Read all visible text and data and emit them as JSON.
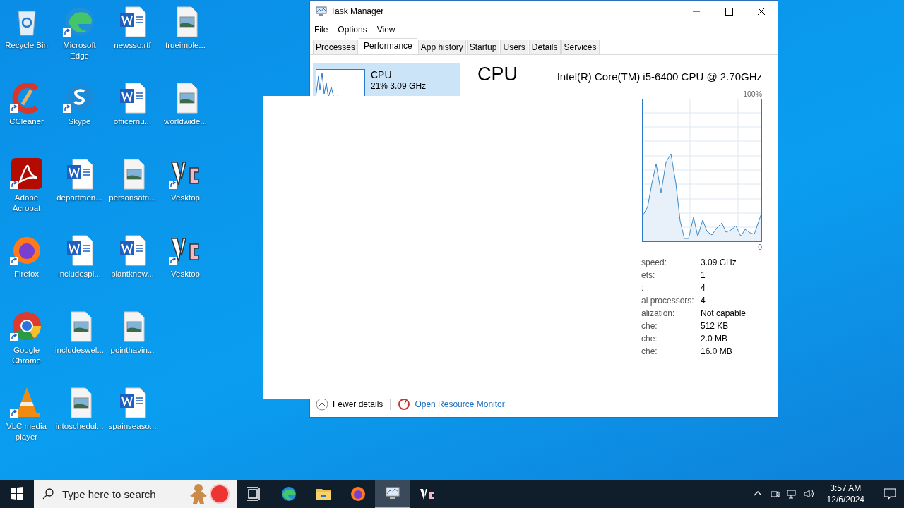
{
  "desktop_icons": [
    {
      "label": "Recycle Bin",
      "kind": "recycle",
      "shortcut": false
    },
    {
      "label": "CCleaner",
      "kind": "ccleaner",
      "shortcut": true
    },
    {
      "label": "Adobe Acrobat",
      "kind": "acrobat",
      "shortcut": true
    },
    {
      "label": "Firefox",
      "kind": "firefox",
      "shortcut": true
    },
    {
      "label": "Google Chrome",
      "kind": "chrome",
      "shortcut": true
    },
    {
      "label": "VLC media player",
      "kind": "vlc",
      "shortcut": true
    },
    {
      "label": "Microsoft Edge",
      "kind": "edge",
      "shortcut": true
    },
    {
      "label": "Skype",
      "kind": "skype",
      "shortcut": true
    },
    {
      "label": "departmen...",
      "kind": "word",
      "shortcut": false
    },
    {
      "label": "includespl...",
      "kind": "word",
      "shortcut": false
    },
    {
      "label": "includeswel...",
      "kind": "image",
      "shortcut": false
    },
    {
      "label": "intoschedul...",
      "kind": "image",
      "shortcut": false
    },
    {
      "label": "newsso.rtf",
      "kind": "word",
      "shortcut": false
    },
    {
      "label": "officernu...",
      "kind": "word",
      "shortcut": false
    },
    {
      "label": "personsafri...",
      "kind": "image",
      "shortcut": false
    },
    {
      "label": "plantknow...",
      "kind": "word",
      "shortcut": false
    },
    {
      "label": "pointhavin...",
      "kind": "image",
      "shortcut": false
    },
    {
      "label": "spainseaso...",
      "kind": "word",
      "shortcut": false
    },
    {
      "label": "trueimple...",
      "kind": "image",
      "shortcut": false
    },
    {
      "label": "worldwide...",
      "kind": "image",
      "shortcut": false
    },
    {
      "label": "Vesktop",
      "kind": "vesktop",
      "shortcut": true
    },
    {
      "label": "Vesktop",
      "kind": "vesktop",
      "shortcut": true
    }
  ],
  "task_manager": {
    "title": "Task Manager",
    "menu": [
      "File",
      "Options",
      "View"
    ],
    "tabs": [
      {
        "label": "Processes",
        "selected": false
      },
      {
        "label": "Performance",
        "selected": true
      },
      {
        "label": "App history",
        "selected": false
      },
      {
        "label": "Startup",
        "selected": false
      },
      {
        "label": "Users",
        "selected": false
      },
      {
        "label": "Details",
        "selected": false
      },
      {
        "label": "Services",
        "selected": false
      }
    ],
    "sidebar": [
      {
        "name": "CPU",
        "detail": "21%  3.09 GHz",
        "selected": true
      }
    ],
    "heading": "CPU",
    "processor": "Intel(R) Core(TM) i5-6400 CPU @ 2.70GHz",
    "graph_max": "100%",
    "graph_min": "0",
    "stats": [
      {
        "label": "speed:",
        "value": "3.09 GHz"
      },
      {
        "label": "ets:",
        "value": "1"
      },
      {
        "label": ":",
        "value": "4"
      },
      {
        "label": "al processors:",
        "value": "4"
      },
      {
        "label": "alization:",
        "value": "Not capable"
      },
      {
        "label": "che:",
        "value": "512 KB"
      },
      {
        "label": "che:",
        "value": "2.0 MB"
      },
      {
        "label": "che:",
        "value": "16.0 MB"
      }
    ],
    "footer": {
      "fewer": "Fewer details",
      "monitor": "Open Resource Monitor"
    }
  },
  "taskbar": {
    "search_placeholder": "Type here to search",
    "apps": [
      {
        "kind": "taskview",
        "active": false
      },
      {
        "kind": "edge",
        "active": false
      },
      {
        "kind": "folder",
        "active": false
      },
      {
        "kind": "firefox",
        "active": false
      },
      {
        "kind": "taskmgr",
        "active": true
      },
      {
        "kind": "vesktop",
        "active": false
      }
    ],
    "time": "3:57 AM",
    "date": "12/6/2024"
  }
}
